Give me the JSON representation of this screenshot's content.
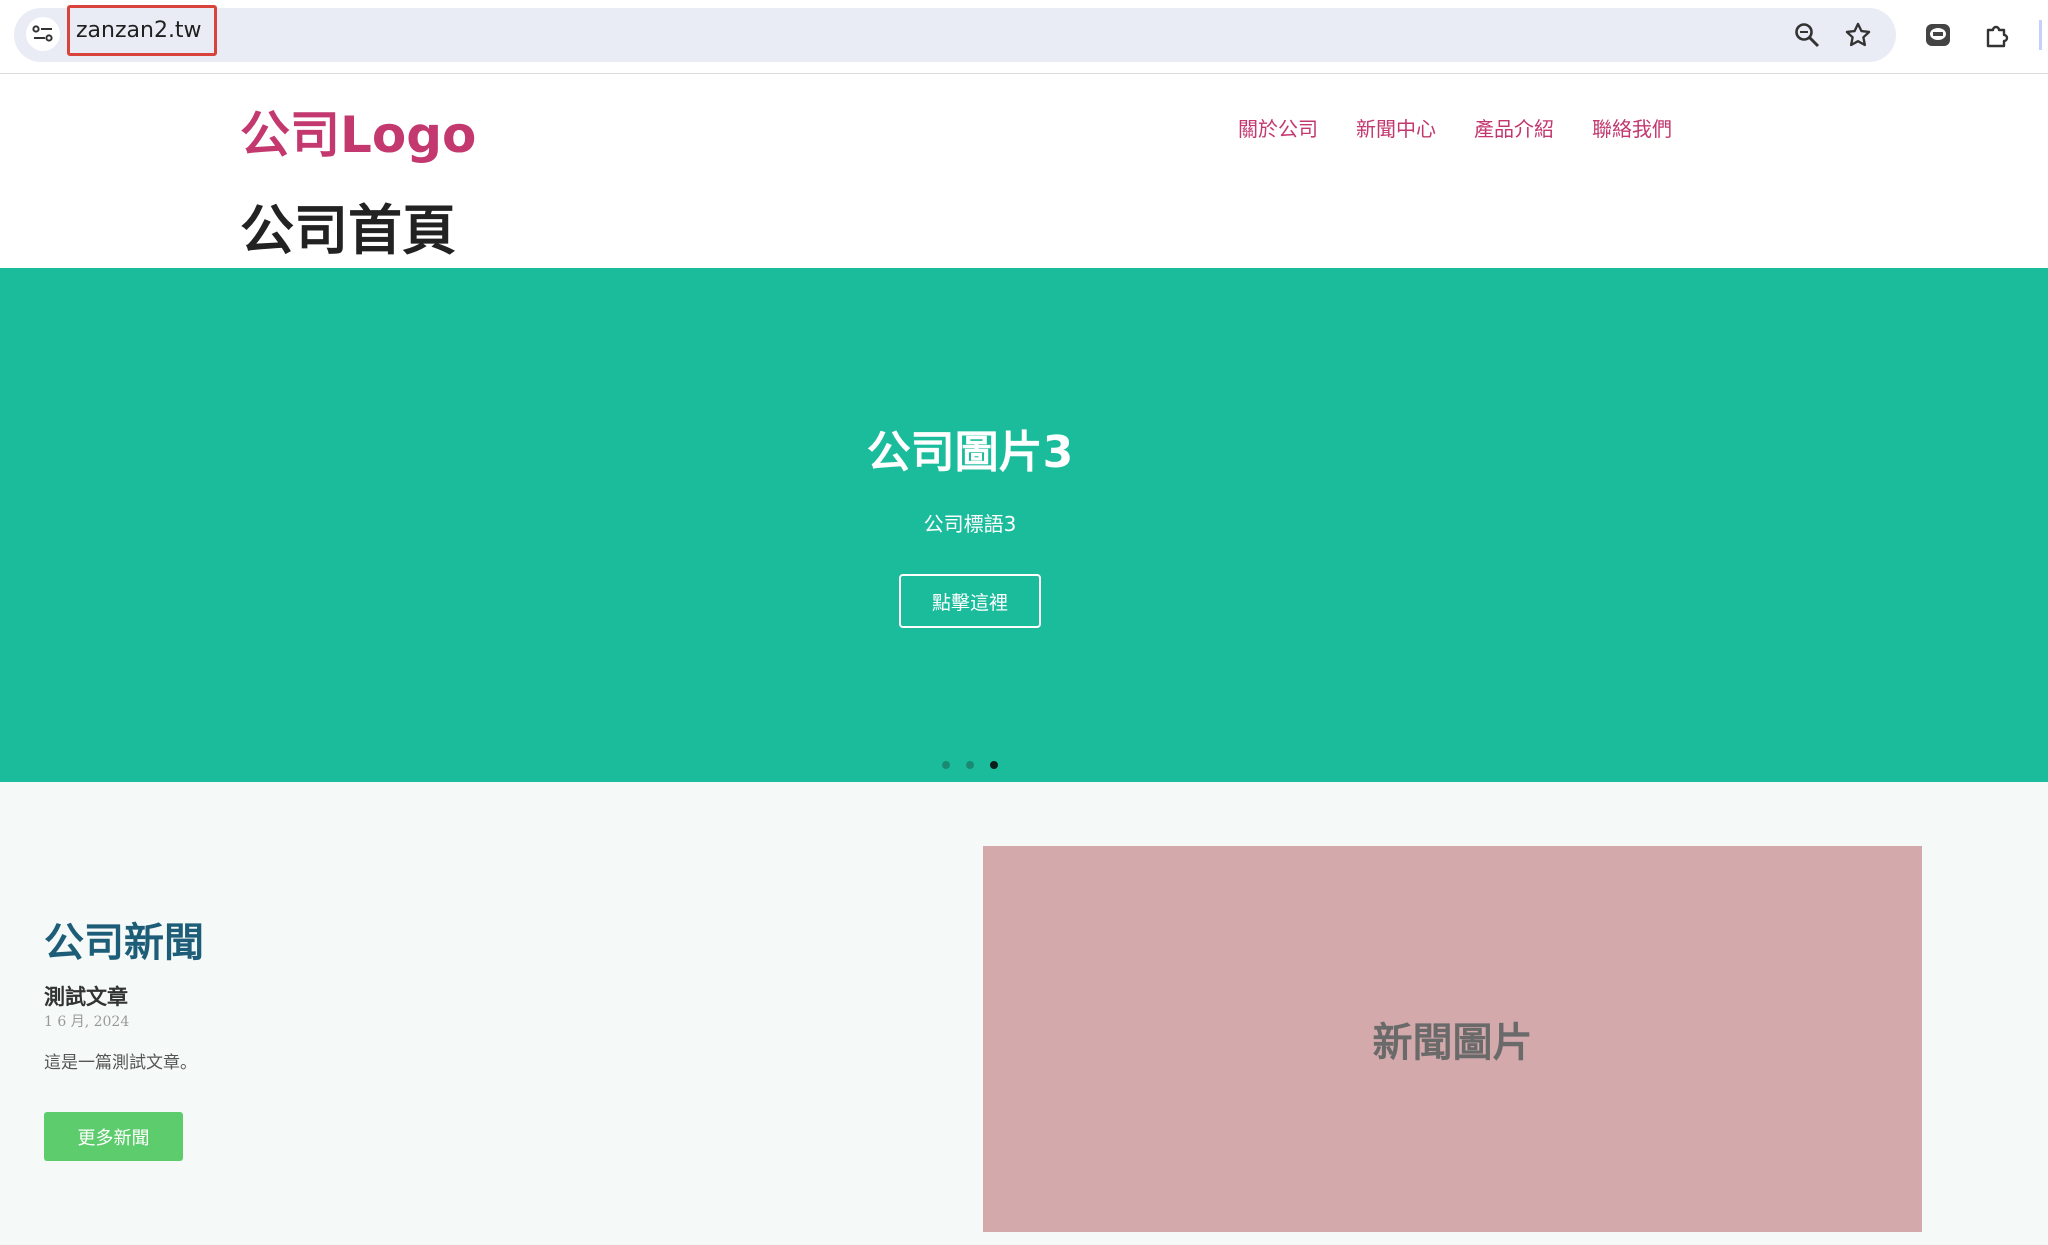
{
  "browser": {
    "url": "zanzan2.tw",
    "icons": [
      "site-info-icon",
      "zoom-icon",
      "bookmark-star-icon",
      "line-extension-icon",
      "extensions-puzzle-icon"
    ]
  },
  "header": {
    "logo": "公司Logo",
    "nav": [
      {
        "label": "關於公司"
      },
      {
        "label": "新聞中心"
      },
      {
        "label": "產品介紹"
      },
      {
        "label": "聯絡我們"
      }
    ],
    "page_title": "公司首頁"
  },
  "hero": {
    "title": "公司圖片3",
    "subtitle": "公司標語3",
    "button_label": "點擊這裡",
    "slide_count": 3,
    "active_slide": 3,
    "background": "#1abc9c"
  },
  "news": {
    "heading": "公司新聞",
    "article": {
      "title": "測試文章",
      "date": "1 6 月, 2024",
      "body": "這是一篇測試文章。"
    },
    "more_button": "更多新聞",
    "image_label": "新聞圖片"
  },
  "colors": {
    "brand": "#c3386e",
    "hero": "#1abc9c",
    "news_heading": "#1d5d78",
    "more_button": "#5ccc6c",
    "image_placeholder": "#d4a9ab"
  }
}
